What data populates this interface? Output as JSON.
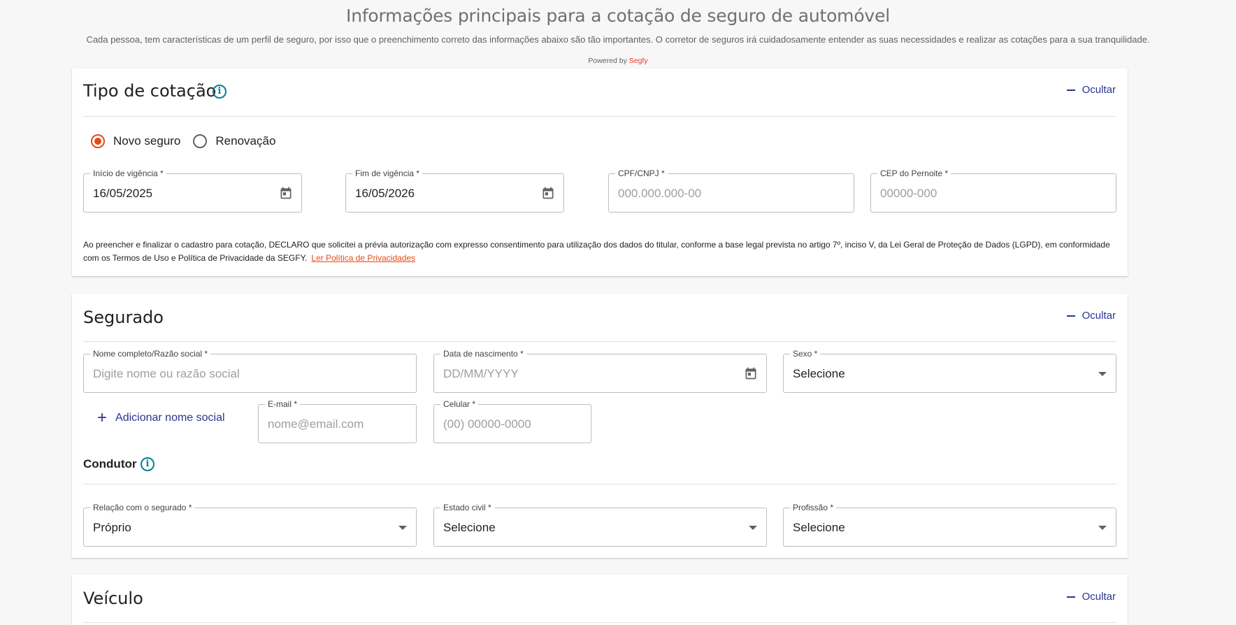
{
  "header": {
    "title": "Informações principais para a cotação de seguro de automóvel",
    "subtitle": "Cada pessoa, tem características de um perfil de seguro, por isso que o preenchimento correto das informações abaixo são tão importantes. O corretor de seguros irá cuidadosamente entender as suas necessidades e realizar as cotações para a sua tranquilidade.",
    "powered_prefix": "Powered by",
    "powered_brand": "Segfy"
  },
  "colors": {
    "accent": "#e64a19",
    "link": "#283593",
    "info": "#00838f"
  },
  "tipo_cotacao": {
    "title": "Tipo de cotação",
    "hide_label": "Ocultar",
    "radio_options": [
      {
        "label": "Novo seguro",
        "checked": true
      },
      {
        "label": "Renovação",
        "checked": false
      }
    ],
    "fields": {
      "inicio": {
        "label": "Início de vigência *",
        "value": "16/05/2025"
      },
      "fim": {
        "label": "Fim de vigência *",
        "value": "16/05/2026"
      },
      "cpf": {
        "label": "CPF/CNPJ *",
        "placeholder": "000.000.000-00"
      },
      "cep": {
        "label": "CEP do Pernoite *",
        "placeholder": "00000-000"
      }
    },
    "lgpd_text": "Ao preencher e finalizar o cadastro para cotação, DECLARO que solicitei a prévia autorização com expresso consentimento para utilização dos dados do titular, conforme a base legal prevista no artigo 7º, inciso V, da Lei Geral de Proteção de Dados (LGPD), em conformidade com os Termos de Uso e Política de Privacidade da SEGFY.",
    "lgpd_link": "Ler Política de Privacidades"
  },
  "segurado": {
    "title": "Segurado",
    "hide_label": "Ocultar",
    "fields": {
      "nome": {
        "label": "Nome completo/Razão social *",
        "placeholder": "Digite nome ou razão social"
      },
      "nascimento": {
        "label": "Data de nascimento *",
        "placeholder": "DD/MM/YYYY"
      },
      "sexo": {
        "label": "Sexo *",
        "value": "Selecione"
      },
      "email": {
        "label": "E-mail *",
        "placeholder": "nome@email.com"
      },
      "celular": {
        "label": "Celular *",
        "placeholder": "(00) 00000-0000"
      }
    },
    "add_social_label": "Adicionar nome social",
    "condutor": {
      "title": "Condutor",
      "fields": {
        "relacao": {
          "label": "Relação com o segurado *",
          "value": "Próprio"
        },
        "estado_civil": {
          "label": "Estado civil *",
          "value": "Selecione"
        },
        "profissao": {
          "label": "Profissão *",
          "value": "Selecione"
        }
      }
    }
  },
  "veiculo": {
    "title": "Veículo",
    "hide_label": "Ocultar"
  }
}
